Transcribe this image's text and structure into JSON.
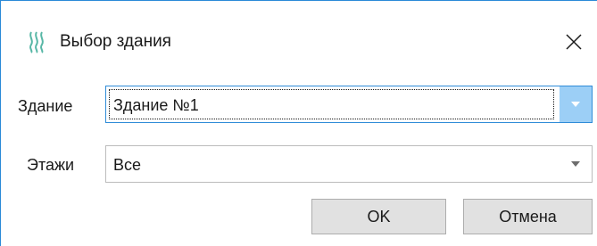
{
  "window": {
    "title": "Выбор здания",
    "app_icon": "steam-waves-icon",
    "close_icon": "close-icon",
    "accent_color": "#2b8ad8"
  },
  "form": {
    "building": {
      "label": "Здание",
      "value": "Здание №1",
      "dropdown_icon": "chevron-down-icon"
    },
    "floors": {
      "label": "Этажи",
      "value": "Все",
      "dropdown_icon": "chevron-down-icon"
    }
  },
  "buttons": {
    "ok_label": "OK",
    "cancel_label": "Отмена"
  }
}
